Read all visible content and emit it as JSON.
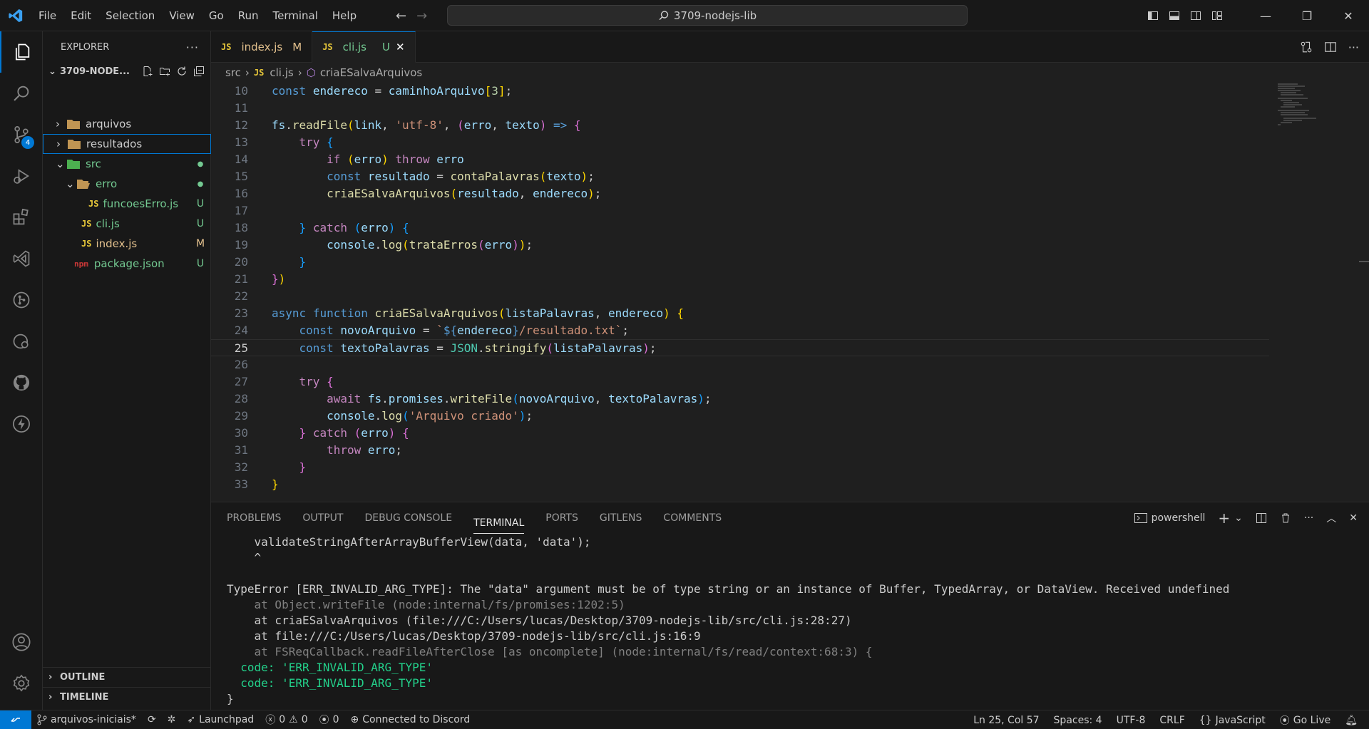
{
  "menu": [
    "File",
    "Edit",
    "Selection",
    "View",
    "Go",
    "Run",
    "Terminal",
    "Help"
  ],
  "command_center": "3709-nodejs-lib",
  "sidebar": {
    "title": "EXPLORER",
    "root": "3709-NODE...",
    "items": [
      {
        "label": "arquivos",
        "status": ""
      },
      {
        "label": "resultados",
        "status": ""
      },
      {
        "label": "src",
        "status": ""
      },
      {
        "label": "erro",
        "status": ""
      },
      {
        "label": "funcoesErro.js",
        "status": "U"
      },
      {
        "label": "cli.js",
        "status": "U"
      },
      {
        "label": "index.js",
        "status": "M"
      },
      {
        "label": "package.json",
        "status": "U"
      }
    ],
    "outline": "OUTLINE",
    "timeline": "TIMELINE"
  },
  "activity_badge": "4",
  "tabs": [
    {
      "name": "index.js",
      "status": "M"
    },
    {
      "name": "cli.js",
      "status": "U"
    }
  ],
  "breadcrumb": {
    "part1": "src",
    "part2": "cli.js",
    "part3": "criaESalvaArquivos"
  },
  "code": {
    "current_line": 25,
    "line_numbers": [
      "10",
      "11",
      "12",
      "13",
      "14",
      "15",
      "16",
      "17",
      "18",
      "19",
      "20",
      "21",
      "22",
      "23",
      "24",
      "25",
      "26",
      "27",
      "28",
      "29",
      "30",
      "31",
      "32",
      "33"
    ]
  },
  "panel": {
    "tabs": [
      "PROBLEMS",
      "OUTPUT",
      "DEBUG CONSOLE",
      "TERMINAL",
      "PORTS",
      "GITLENS",
      "COMMENTS"
    ],
    "shell": "powershell",
    "terminal_lines": [
      "    validateStringAfterArrayBufferView(data, 'data');",
      "    ^",
      "",
      "TypeError [ERR_INVALID_ARG_TYPE]: The \"data\" argument must be of type string or an instance of Buffer, TypedArray, or DataView. Received undefined",
      "    at Object.writeFile (node:internal/fs/promises:1202:5)",
      "    at criaESalvaArquivos (file:///C:/Users/lucas/Desktop/3709-nodejs-lib/src/cli.js:28:27)",
      "    at file:///C:/Users/lucas/Desktop/3709-nodejs-lib/src/cli.js:16:9",
      "    at FSReqCallback.readFileAfterClose [as oncomplete] (node:internal/fs/read/context:68:3) {",
      "  code: 'ERR_INVALID_ARG_TYPE'",
      "  code: 'ERR_INVALID_ARG_TYPE'",
      "}"
    ]
  },
  "status": {
    "branch": "arquivos-iniciais*",
    "launchpad": "Launchpad",
    "errors": "0",
    "warnings": "0",
    "ports": "0",
    "discord": "Connected to Discord",
    "position": "Ln 25, Col 57",
    "spaces": "Spaces: 4",
    "encoding": "UTF-8",
    "eol": "CRLF",
    "language": "JavaScript",
    "golive": "Go Live"
  },
  "colors": {
    "accent": "#0078d4",
    "modified": "#e2c08d",
    "untracked": "#73c991"
  }
}
